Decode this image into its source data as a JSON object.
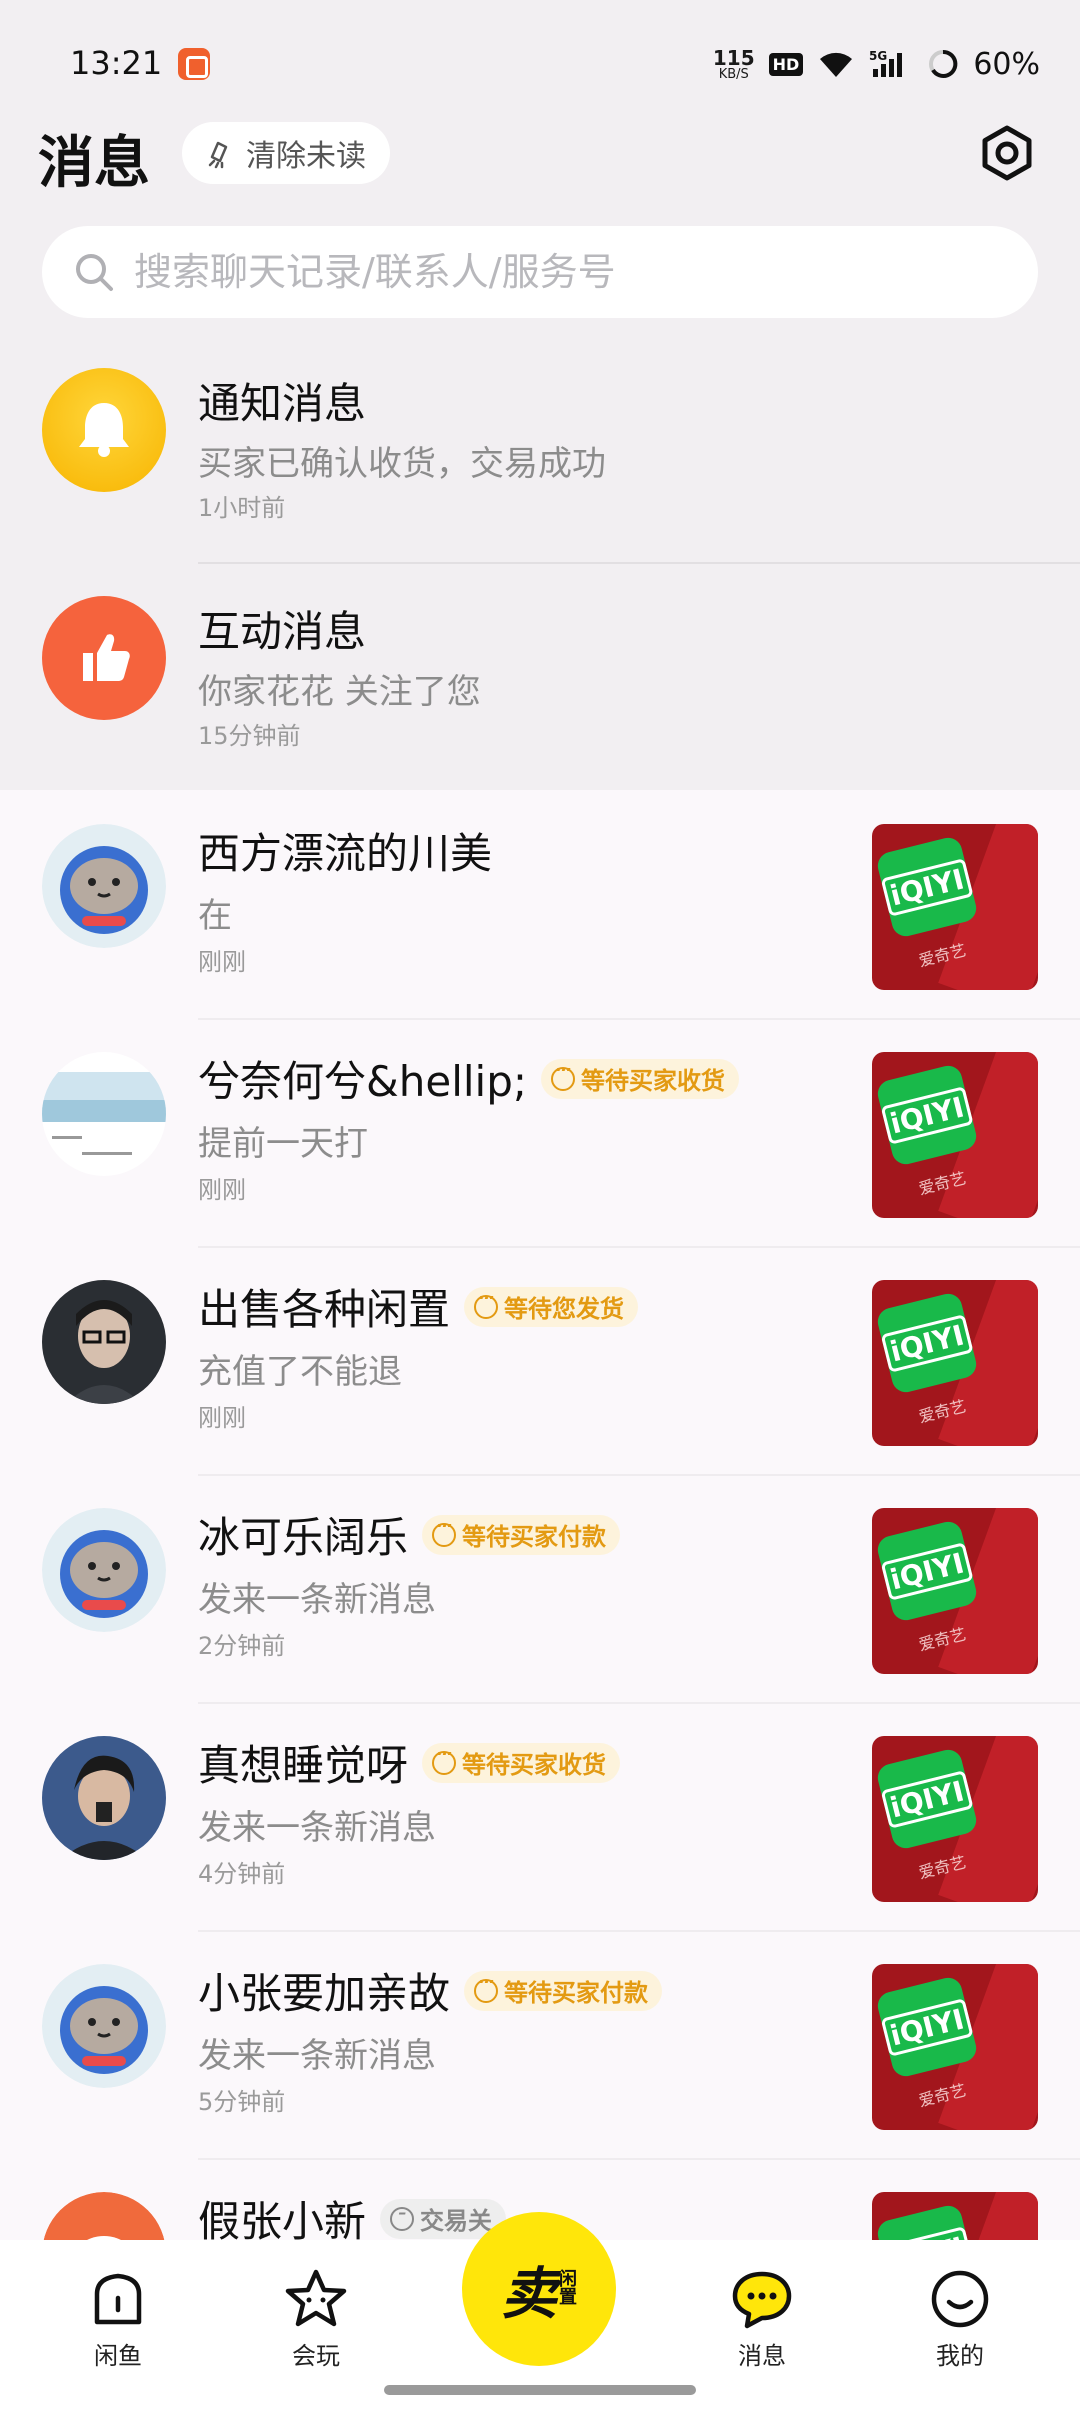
{
  "status_bar": {
    "time": "13:21",
    "net_speed_value": "115",
    "net_speed_unit": "KB/S",
    "hd": "HD",
    "signal": "5G",
    "battery": "60%"
  },
  "header": {
    "title": "消息",
    "clear_unread": "清除未读"
  },
  "search": {
    "placeholder": "搜索聊天记录/联系人/服务号"
  },
  "system_messages": [
    {
      "title": "通知消息",
      "subtitle": "买家已确认收货，交易成功",
      "time": "1小时前",
      "icon": "bell-icon",
      "color": "#ffc800"
    },
    {
      "title": "互动消息",
      "subtitle": "你家花花 关注了您",
      "time": "15分钟前",
      "icon": "thumbs-up-icon",
      "color": "#f5633d"
    }
  ],
  "chats": [
    {
      "name": "西方漂流的川美",
      "tag": "",
      "message": "在",
      "time": "刚刚",
      "avatar": "cat-astronaut-avatar",
      "thumb_brand": "爱奇艺"
    },
    {
      "name": "兮奈何兮&hellip;",
      "tag": "等待买家收货",
      "message": "提前一天打",
      "time": "刚刚",
      "avatar": "scenery-avatar",
      "thumb_brand": "爱奇艺"
    },
    {
      "name": "出售各种闲置",
      "tag": "等待您发货",
      "message": "充值了不能退",
      "time": "刚刚",
      "avatar": "man-glasses-avatar",
      "thumb_brand": "爱奇艺"
    },
    {
      "name": "冰可乐阔乐",
      "tag": "等待买家付款",
      "message": "发来一条新消息",
      "time": "2分钟前",
      "avatar": "cat-astronaut-avatar",
      "thumb_brand": "爱奇艺"
    },
    {
      "name": "真想睡觉呀",
      "tag": "等待买家收货",
      "message": "发来一条新消息",
      "time": "4分钟前",
      "avatar": "young-man-avatar",
      "thumb_brand": "爱奇艺"
    },
    {
      "name": "小张要加亲故",
      "tag": "等待买家付款",
      "message": "发来一条新消息",
      "time": "5分钟前",
      "avatar": "cat-astronaut-avatar",
      "thumb_brand": "爱奇艺"
    },
    {
      "name": "假张小新",
      "tag": "交易关",
      "message": "",
      "time": "",
      "avatar": "cartoon-avatar",
      "thumb_brand": ""
    }
  ],
  "thumb_logo": "iQIYI",
  "bottom_nav": {
    "items": [
      {
        "label": "闲鱼",
        "icon": "home-icon"
      },
      {
        "label": "会玩",
        "icon": "star-face-icon"
      },
      {
        "label": "消息",
        "icon": "chat-bubble-icon",
        "active": true
      },
      {
        "label": "我的",
        "icon": "smile-icon"
      }
    ],
    "sell_main": "卖",
    "sell_sub_1": "闲",
    "sell_sub_2": "置"
  },
  "colors": {
    "accent_yellow": "#ffe60a",
    "tag_text": "#e39a12",
    "tag_bg": "#fdf3dc"
  }
}
